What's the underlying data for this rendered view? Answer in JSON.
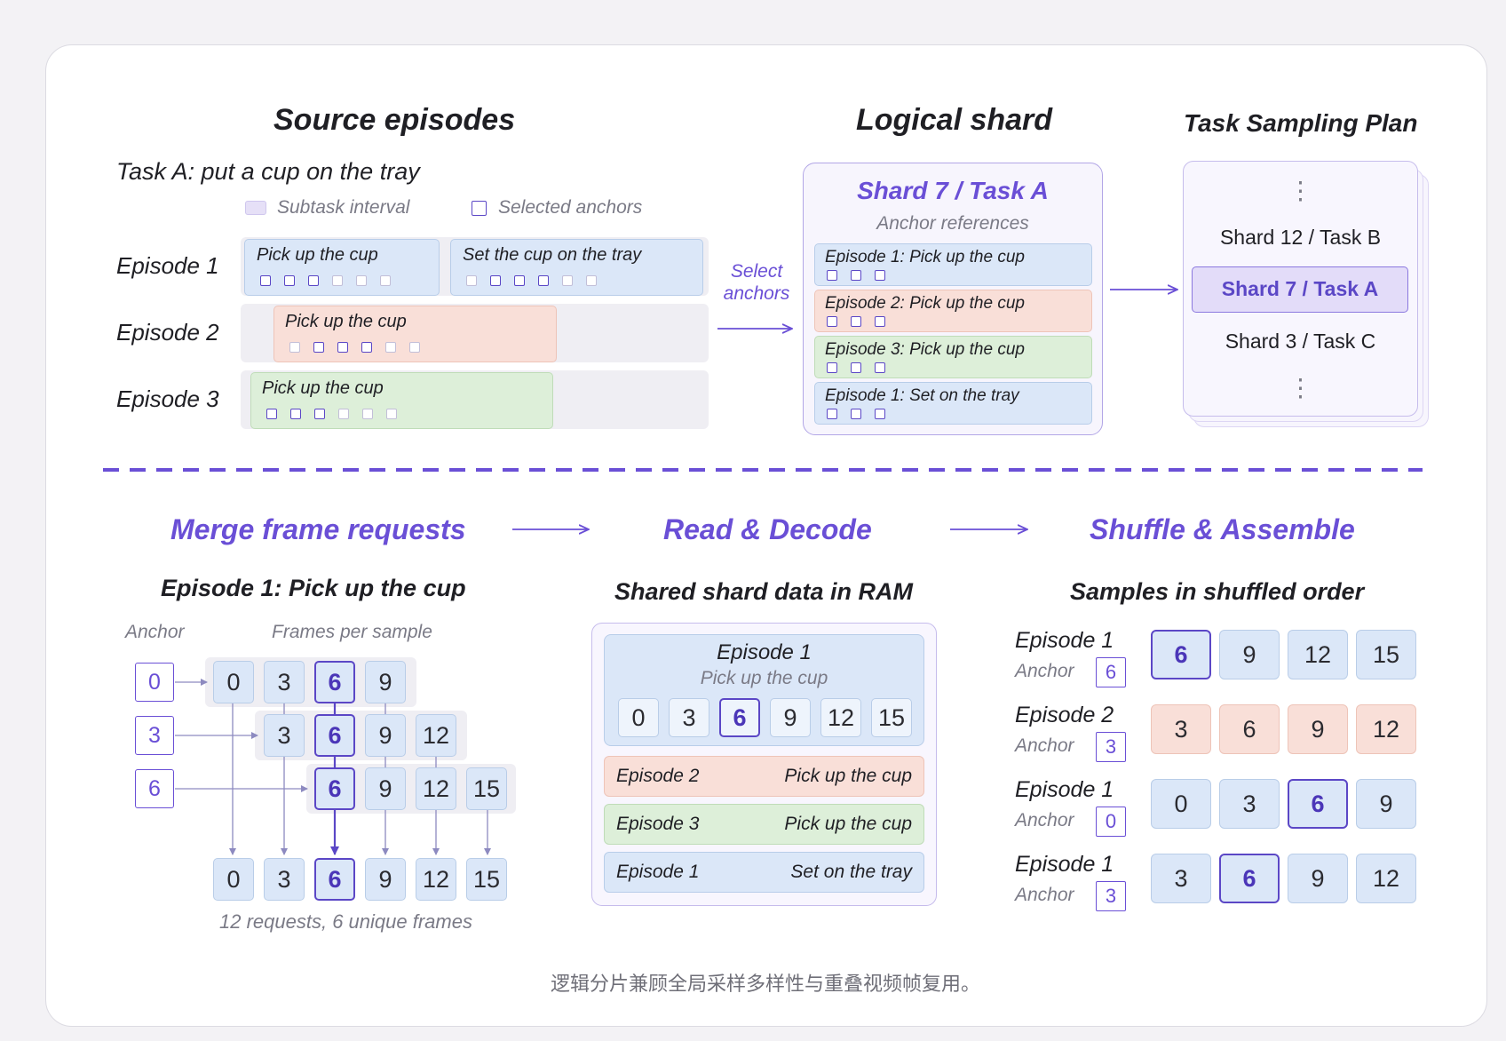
{
  "colors": {
    "accent": "#6a4fd6",
    "blue": "#dbe7f8",
    "pink": "#f9dfd8",
    "green": "#ddefd9"
  },
  "source": {
    "title": "Source episodes",
    "task": "Task A: put a cup on the tray",
    "legend_interval": "Subtask interval",
    "legend_anchors": "Selected anchors",
    "episodes": [
      "Episode 1",
      "Episode 2",
      "Episode 3"
    ],
    "seg_pick": "Pick up the cup",
    "seg_set": "Set the cup on the tray",
    "arrow_label_1": "Select",
    "arrow_label_2": "anchors"
  },
  "shard": {
    "title": "Logical shard",
    "name": "Shard 7 / Task A",
    "subtitle": "Anchor references",
    "refs": [
      "Episode 1: Pick up the cup",
      "Episode 2: Pick up the cup",
      "Episode 3: Pick up the cup",
      "Episode 1: Set on the tray"
    ]
  },
  "plan": {
    "title": "Task Sampling Plan",
    "dots": "⋮",
    "items": [
      "Shard 12 / Task B",
      "Shard 7 / Task A",
      "Shard 3 / Task C"
    ]
  },
  "steps": {
    "merge": "Merge frame requests",
    "read": "Read & Decode",
    "shuffle": "Shuffle & Assemble"
  },
  "merge": {
    "subtitle": "Episode 1: Pick up the cup",
    "anchor_label": "Anchor",
    "frames_label": "Frames per sample",
    "anchors": [
      "0",
      "3",
      "6"
    ],
    "row1": [
      "0",
      "3",
      "6",
      "9"
    ],
    "row2": [
      "3",
      "6",
      "9",
      "12"
    ],
    "row3": [
      "6",
      "9",
      "12",
      "15"
    ],
    "merged": [
      "0",
      "3",
      "6",
      "9",
      "12",
      "15"
    ],
    "summary": "12 requests, 6 unique frames"
  },
  "ram": {
    "subtitle": "Shared shard data in RAM",
    "ep1": "Episode 1",
    "ep1_task": "Pick up the cup",
    "frames": [
      "0",
      "3",
      "6",
      "9",
      "12",
      "15"
    ],
    "rows": [
      {
        "ep": "Episode 2",
        "task": "Pick up the cup"
      },
      {
        "ep": "Episode 3",
        "task": "Pick up the cup"
      },
      {
        "ep": "Episode 1",
        "task": "Set on the tray"
      }
    ]
  },
  "samples": {
    "subtitle": "Samples in shuffled order",
    "anchor_word": "Anchor",
    "rows": [
      {
        "ep": "Episode 1",
        "anchor": "6",
        "frames": [
          "6",
          "9",
          "12",
          "15"
        ]
      },
      {
        "ep": "Episode 2",
        "anchor": "3",
        "frames": [
          "3",
          "6",
          "9",
          "12"
        ]
      },
      {
        "ep": "Episode 1",
        "anchor": "0",
        "frames": [
          "0",
          "3",
          "6",
          "9"
        ]
      },
      {
        "ep": "Episode 1",
        "anchor": "3",
        "frames": [
          "3",
          "6",
          "9",
          "12"
        ]
      }
    ]
  },
  "caption": "逻辑分片兼顾全局采样多样性与重叠视频帧复用。"
}
